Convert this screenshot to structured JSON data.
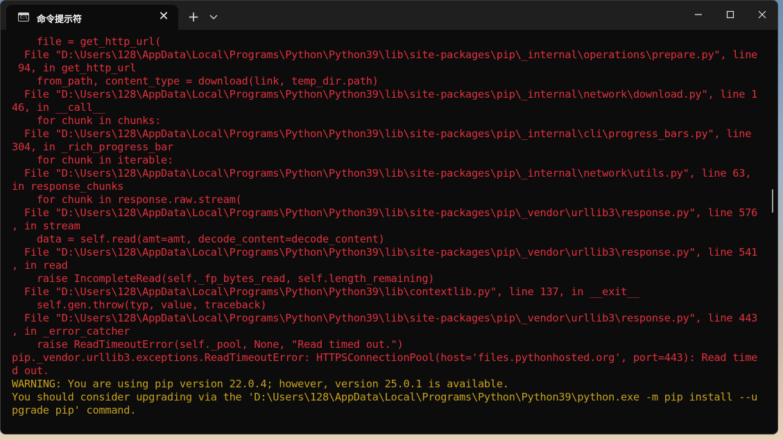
{
  "window": {
    "tab_title": "命令提示符",
    "tab_icon_text": "C:\\",
    "tab_close": "✕",
    "new_tab": "+"
  },
  "colors": {
    "error_text": "#e1313e",
    "warning_text": "#c7a21f",
    "background": "#0c0c0c"
  },
  "console": {
    "lines": [
      {
        "text": "    file = get_http_url(",
        "style": "err"
      },
      {
        "text": "  File \"D:\\Users\\128\\AppData\\Local\\Programs\\Python\\Python39\\lib\\site-packages\\pip\\_internal\\operations\\prepare.py\", line",
        "style": "err"
      },
      {
        "text": " 94, in get_http_url",
        "style": "err"
      },
      {
        "text": "    from_path, content_type = download(link, temp_dir.path)",
        "style": "err"
      },
      {
        "text": "  File \"D:\\Users\\128\\AppData\\Local\\Programs\\Python\\Python39\\lib\\site-packages\\pip\\_internal\\network\\download.py\", line 1",
        "style": "err"
      },
      {
        "text": "46, in __call__",
        "style": "err"
      },
      {
        "text": "    for chunk in chunks:",
        "style": "err"
      },
      {
        "text": "  File \"D:\\Users\\128\\AppData\\Local\\Programs\\Python\\Python39\\lib\\site-packages\\pip\\_internal\\cli\\progress_bars.py\", line",
        "style": "err"
      },
      {
        "text": "304, in _rich_progress_bar",
        "style": "err"
      },
      {
        "text": "    for chunk in iterable:",
        "style": "err"
      },
      {
        "text": "  File \"D:\\Users\\128\\AppData\\Local\\Programs\\Python\\Python39\\lib\\site-packages\\pip\\_internal\\network\\utils.py\", line 63,",
        "style": "err"
      },
      {
        "text": "in response_chunks",
        "style": "err"
      },
      {
        "text": "    for chunk in response.raw.stream(",
        "style": "err"
      },
      {
        "text": "  File \"D:\\Users\\128\\AppData\\Local\\Programs\\Python\\Python39\\lib\\site-packages\\pip\\_vendor\\urllib3\\response.py\", line 576",
        "style": "err"
      },
      {
        "text": ", in stream",
        "style": "err"
      },
      {
        "text": "    data = self.read(amt=amt, decode_content=decode_content)",
        "style": "err"
      },
      {
        "text": "  File \"D:\\Users\\128\\AppData\\Local\\Programs\\Python\\Python39\\lib\\site-packages\\pip\\_vendor\\urllib3\\response.py\", line 541",
        "style": "err"
      },
      {
        "text": ", in read",
        "style": "err"
      },
      {
        "text": "    raise IncompleteRead(self._fp_bytes_read, self.length_remaining)",
        "style": "err"
      },
      {
        "text": "  File \"D:\\Users\\128\\AppData\\Local\\Programs\\Python\\Python39\\lib\\contextlib.py\", line 137, in __exit__",
        "style": "err"
      },
      {
        "text": "    self.gen.throw(typ, value, traceback)",
        "style": "err"
      },
      {
        "text": "  File \"D:\\Users\\128\\AppData\\Local\\Programs\\Python\\Python39\\lib\\site-packages\\pip\\_vendor\\urllib3\\response.py\", line 443",
        "style": "err"
      },
      {
        "text": ", in _error_catcher",
        "style": "err"
      },
      {
        "text": "    raise ReadTimeoutError(self._pool, None, \"Read timed out.\")",
        "style": "err"
      },
      {
        "text": "pip._vendor.urllib3.exceptions.ReadTimeoutError: HTTPSConnectionPool(host='files.pythonhosted.org', port=443): Read time",
        "style": "err"
      },
      {
        "text": "d out.",
        "style": "err"
      },
      {
        "text": "WARNING: You are using pip version 22.0.4; however, version 25.0.1 is available.",
        "style": "warn"
      },
      {
        "text": "You should consider upgrading via the 'D:\\Users\\128\\AppData\\Local\\Programs\\Python\\Python39\\python.exe -m pip install --u",
        "style": "warn"
      },
      {
        "text": "pgrade pip' command.",
        "style": "warn"
      }
    ]
  }
}
